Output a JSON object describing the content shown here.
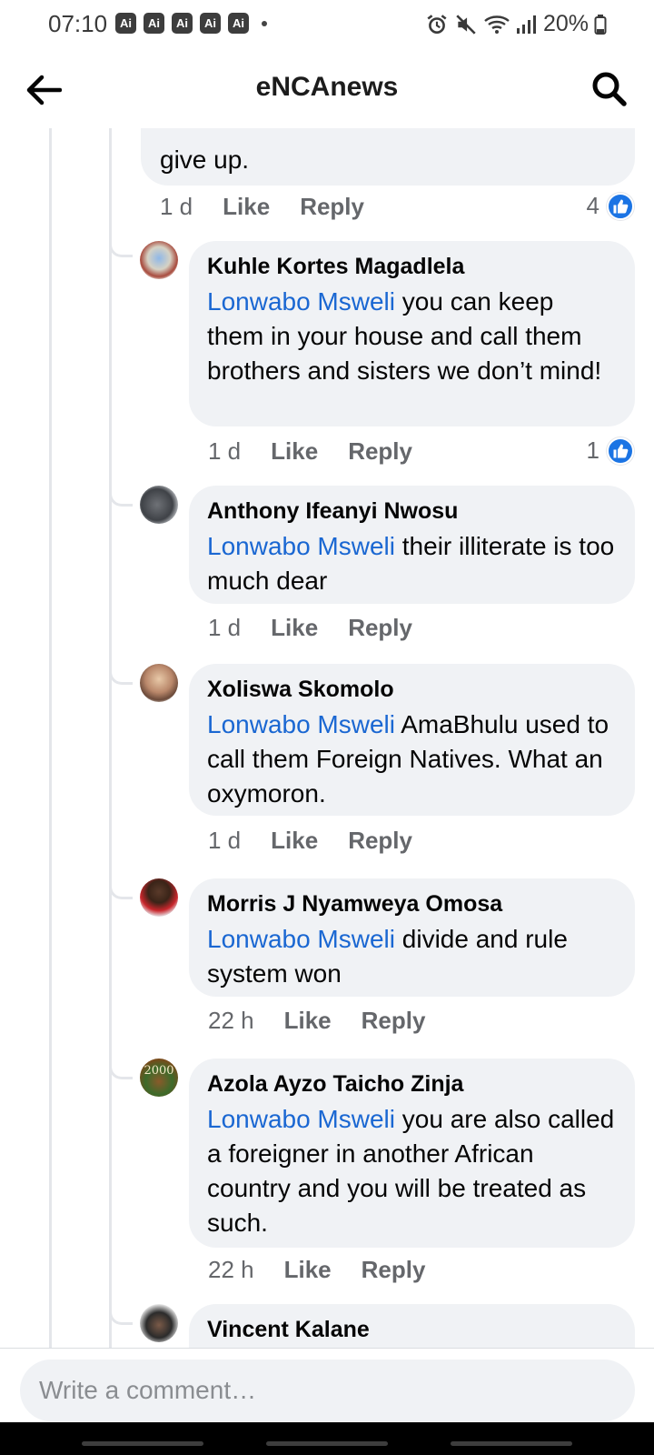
{
  "status_bar": {
    "time": "07:10",
    "ai_badges": [
      "Ai",
      "Ai",
      "Ai",
      "Ai",
      "Ai"
    ],
    "battery": "20%",
    "icons": [
      "alarm-icon",
      "mute-icon",
      "wifi-icon",
      "signal-icon",
      "battery-icon"
    ]
  },
  "header": {
    "title": "eNCAnews",
    "back_icon": "arrow-left-icon",
    "search_icon": "search-icon"
  },
  "parent_comment": {
    "last_line": "give up.",
    "time": "1 d",
    "like_label": "Like",
    "reply_label": "Reply",
    "reaction_count": "4"
  },
  "replies": [
    {
      "author": "Kuhle Kortes Magadlela",
      "mention": "Lonwabo Msweli",
      "text": " you can keep them in your house and call them brothers and sisters we don’t mind!",
      "time": "1 d",
      "like_label": "Like",
      "reply_label": "Reply",
      "reaction_count": "1"
    },
    {
      "author": "Anthony Ifeanyi Nwosu",
      "mention": "Lonwabo Msweli",
      "text": " their illiterate is too much dear",
      "time": "1 d",
      "like_label": "Like",
      "reply_label": "Reply"
    },
    {
      "author": "Xoliswa Skomolo",
      "mention": "Lonwabo Msweli",
      "text": " AmaBhulu used to call them Foreign Natives. What an oxymoron.",
      "time": "1 d",
      "like_label": "Like",
      "reply_label": "Reply"
    },
    {
      "author": "Morris J Nyamweya Omosa",
      "mention": "Lonwabo Msweli",
      "text": " divide and rule system won",
      "time": "22 h",
      "like_label": "Like",
      "reply_label": "Reply"
    },
    {
      "author": "Azola Ayzo Taicho Zinja",
      "mention": "Lonwabo Msweli",
      "text": " you are also called a foreigner in another African country and you will be treated as such.",
      "time": "22 h",
      "like_label": "Like",
      "reply_label": "Reply",
      "avatar_text": "2000"
    },
    {
      "author": "Vincent Kalane"
    }
  ],
  "composer": {
    "placeholder": "Write a comment…"
  },
  "colors": {
    "mention": "#1a67d2",
    "bubble": "#f0f2f5",
    "like_blue": "#1b74e4",
    "secondary_text": "#65676b"
  }
}
